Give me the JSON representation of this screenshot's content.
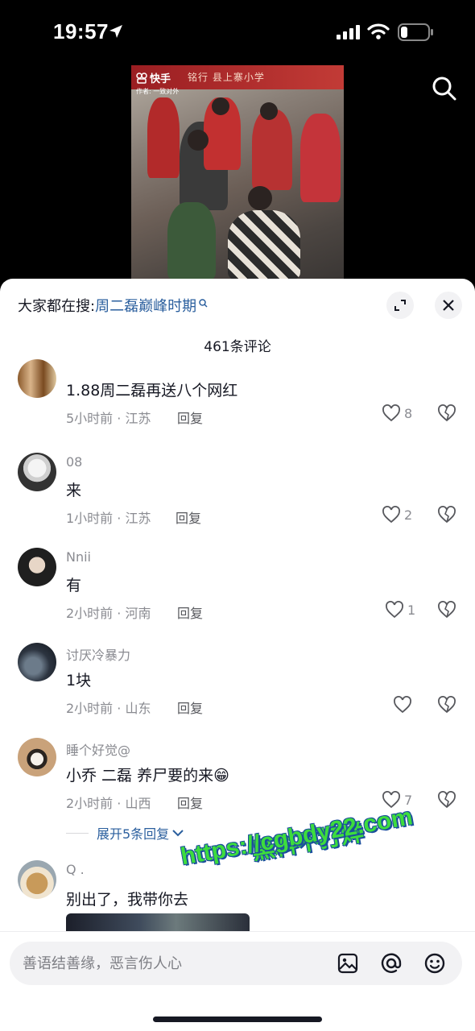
{
  "status_bar": {
    "time": "19:57"
  },
  "video": {
    "watermark_label": "快手",
    "author_label": "作者: 一致对外",
    "banner_text": "铭行 县上寨小学"
  },
  "sheet": {
    "hot_search_prefix": "大家都在搜:",
    "hot_search_keyword": "周二磊巅峰时期",
    "comment_count": "461条评论"
  },
  "comments": [
    {
      "username": "",
      "text": "1.88周二磊再送八个网红",
      "time_location": "5小时前 · 江苏",
      "reply_label": "回复",
      "likes": "8"
    },
    {
      "username": "08",
      "text": "来",
      "time_location": "1小时前 · 江苏",
      "reply_label": "回复",
      "likes": "2"
    },
    {
      "username": "Nnii",
      "text": "有",
      "time_location": "2小时前 · 河南",
      "reply_label": "回复",
      "likes": "1"
    },
    {
      "username": "讨厌冷暴力",
      "text": "1块",
      "time_location": "2小时前 · 山东",
      "reply_label": "回复",
      "likes": ""
    },
    {
      "username": "睡个好觉@",
      "text": "小乔 二磊 养尸要的来😁",
      "time_location": "2小时前 · 山西",
      "reply_label": "回复",
      "likes": "7"
    },
    {
      "username": "Q .",
      "text": "别出了，我带你去",
      "time_location": "",
      "reply_label": "",
      "likes": ""
    }
  ],
  "expand_replies": "展开5条回复",
  "overlay_watermark": {
    "line1": "黑料不打烊",
    "line2": "https://cgbdy22.com"
  },
  "input": {
    "placeholder": "善语结善缘，恶言伤人心"
  },
  "colors": {
    "link": "#2b5f9e",
    "text": "#161823",
    "secondary": "#8a8b91",
    "watermark": "#3ddc3d"
  }
}
